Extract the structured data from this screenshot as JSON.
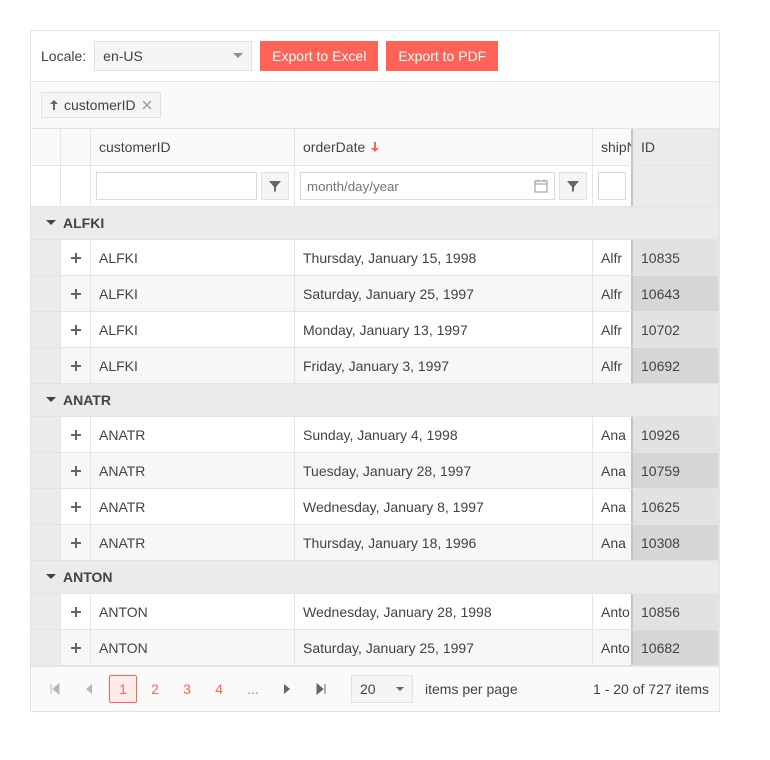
{
  "toolbar": {
    "locale_label": "Locale:",
    "locale_value": "en-US",
    "export_excel": "Export to Excel",
    "export_pdf": "Export to PDF"
  },
  "group_bar": {
    "chip_label": "customerID"
  },
  "columns": {
    "customerID": "customerID",
    "orderDate": "orderDate",
    "shipName": "shipName",
    "id": "ID"
  },
  "filter": {
    "date_placeholder": "month/day/year"
  },
  "groups": [
    {
      "name": "ALFKI",
      "rows": [
        {
          "customerID": "ALFKI",
          "orderDate": "Thursday, January 15, 1998",
          "shipName": "Alfreds Futterkiste",
          "id": "10835"
        },
        {
          "customerID": "ALFKI",
          "orderDate": "Saturday, January 25, 1997",
          "shipName": "Alfreds Futterkiste",
          "id": "10643"
        },
        {
          "customerID": "ALFKI",
          "orderDate": "Monday, January 13, 1997",
          "shipName": "Alfreds Futterkiste",
          "id": "10702"
        },
        {
          "customerID": "ALFKI",
          "orderDate": "Friday, January 3, 1997",
          "shipName": "Alfreds Futterkiste",
          "id": "10692"
        }
      ]
    },
    {
      "name": "ANATR",
      "rows": [
        {
          "customerID": "ANATR",
          "orderDate": "Sunday, January 4, 1998",
          "shipName": "Ana Trujillo",
          "id": "10926"
        },
        {
          "customerID": "ANATR",
          "orderDate": "Tuesday, January 28, 1997",
          "shipName": "Ana Trujillo",
          "id": "10759"
        },
        {
          "customerID": "ANATR",
          "orderDate": "Wednesday, January 8, 1997",
          "shipName": "Ana Trujillo",
          "id": "10625"
        },
        {
          "customerID": "ANATR",
          "orderDate": "Thursday, January 18, 1996",
          "shipName": "Ana Trujillo",
          "id": "10308"
        }
      ]
    },
    {
      "name": "ANTON",
      "rows": [
        {
          "customerID": "ANTON",
          "orderDate": "Wednesday, January 28, 1998",
          "shipName": "Antonio Moreno",
          "id": "10856"
        },
        {
          "customerID": "ANTON",
          "orderDate": "Saturday, January 25, 1997",
          "shipName": "Antonio Moreno",
          "id": "10682"
        }
      ]
    }
  ],
  "pager": {
    "pages": [
      "1",
      "2",
      "3",
      "4"
    ],
    "dots": "...",
    "page_size": "20",
    "items_per_page": "items per page",
    "info": "1 - 20 of 727 items"
  }
}
